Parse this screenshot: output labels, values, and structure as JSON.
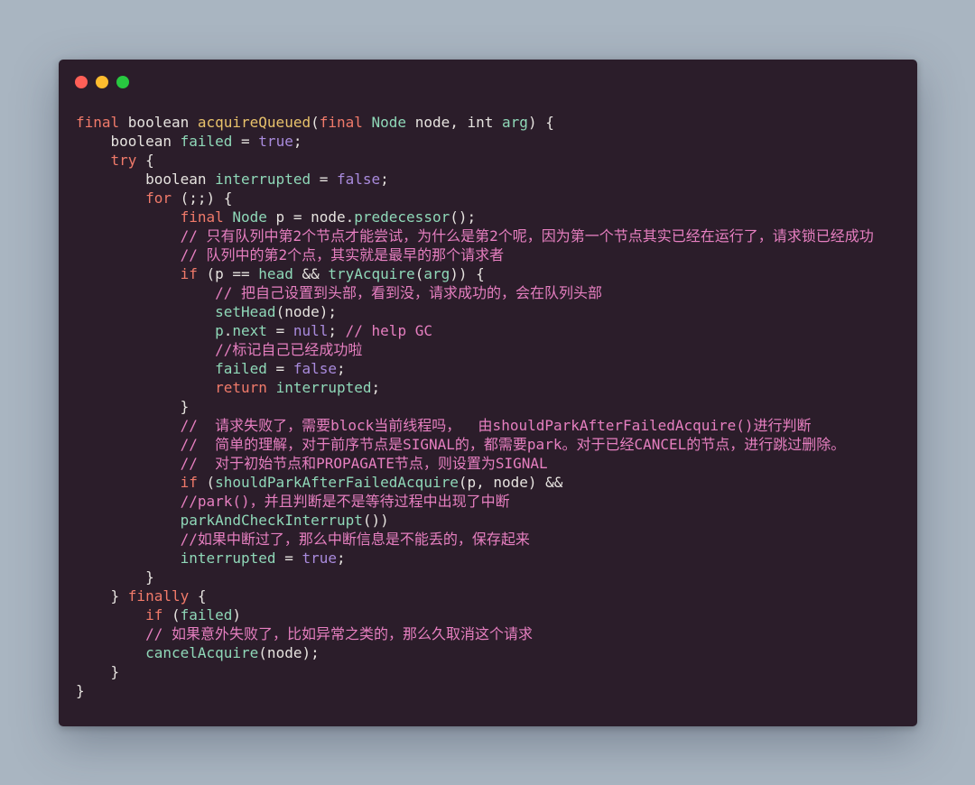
{
  "window": {
    "controls": [
      {
        "name": "close-dot",
        "color": "#ff5f57"
      },
      {
        "name": "minimize-dot",
        "color": "#febc2e"
      },
      {
        "name": "maximize-dot",
        "color": "#28c840"
      }
    ]
  },
  "code": {
    "lines": [
      [
        [
          "kw",
          "final "
        ],
        [
          "type",
          "boolean "
        ],
        [
          "fn",
          "acquireQueued"
        ],
        [
          "plain",
          "("
        ],
        [
          "kw",
          "final "
        ],
        [
          "var",
          "Node "
        ],
        [
          "plain",
          "node, "
        ],
        [
          "type",
          "int "
        ],
        [
          "var",
          "arg"
        ],
        [
          "plain",
          ") {"
        ]
      ],
      [
        [
          "plain",
          "    "
        ],
        [
          "type",
          "boolean "
        ],
        [
          "var",
          "failed"
        ],
        [
          "plain",
          " = "
        ],
        [
          "lit",
          "true"
        ],
        [
          "plain",
          ";"
        ]
      ],
      [
        [
          "plain",
          "    "
        ],
        [
          "kw",
          "try"
        ],
        [
          "plain",
          " {"
        ]
      ],
      [
        [
          "plain",
          "        "
        ],
        [
          "type",
          "boolean "
        ],
        [
          "var",
          "interrupted"
        ],
        [
          "plain",
          " = "
        ],
        [
          "lit",
          "false"
        ],
        [
          "plain",
          ";"
        ]
      ],
      [
        [
          "plain",
          "        "
        ],
        [
          "kw",
          "for"
        ],
        [
          "plain",
          " (;;) {"
        ]
      ],
      [
        [
          "plain",
          "            "
        ],
        [
          "kw",
          "final "
        ],
        [
          "var",
          "Node"
        ],
        [
          "plain",
          " p = node."
        ],
        [
          "var",
          "predecessor"
        ],
        [
          "plain",
          "();"
        ]
      ],
      [
        [
          "plain",
          "            "
        ],
        [
          "cmt",
          "// 只有队列中第2个节点才能尝试，为什么是第2个呢，因为第一个节点其实已经在运行了，请求锁已经成功"
        ]
      ],
      [
        [
          "plain",
          "            "
        ],
        [
          "cmt",
          "// 队列中的第2个点，其实就是最早的那个请求者"
        ]
      ],
      [
        [
          "plain",
          "            "
        ],
        [
          "kw",
          "if"
        ],
        [
          "plain",
          " (p == "
        ],
        [
          "var",
          "head"
        ],
        [
          "plain",
          " && "
        ],
        [
          "var",
          "tryAcquire"
        ],
        [
          "plain",
          "("
        ],
        [
          "var",
          "arg"
        ],
        [
          "plain",
          ")) {"
        ]
      ],
      [
        [
          "plain",
          "                "
        ],
        [
          "cmt",
          "// 把自己设置到头部，看到没，请求成功的，会在队列头部"
        ]
      ],
      [
        [
          "plain",
          "                "
        ],
        [
          "var",
          "setHead"
        ],
        [
          "plain",
          "(node);"
        ]
      ],
      [
        [
          "plain",
          "                "
        ],
        [
          "var",
          "p"
        ],
        [
          "plain",
          "."
        ],
        [
          "var",
          "next"
        ],
        [
          "plain",
          " = "
        ],
        [
          "lit",
          "null"
        ],
        [
          "plain",
          "; "
        ],
        [
          "cmt",
          "// help GC"
        ]
      ],
      [
        [
          "plain",
          "                "
        ],
        [
          "cmt",
          "//标记自己已经成功啦"
        ]
      ],
      [
        [
          "plain",
          "                "
        ],
        [
          "var",
          "failed"
        ],
        [
          "plain",
          " = "
        ],
        [
          "lit",
          "false"
        ],
        [
          "plain",
          ";"
        ]
      ],
      [
        [
          "plain",
          "                "
        ],
        [
          "kw",
          "return "
        ],
        [
          "var",
          "interrupted"
        ],
        [
          "plain",
          ";"
        ]
      ],
      [
        [
          "plain",
          "            }"
        ]
      ],
      [
        [
          "plain",
          "            "
        ],
        [
          "cmt",
          "//  请求失败了，需要block当前线程吗，  由shouldParkAfterFailedAcquire()进行判断"
        ]
      ],
      [
        [
          "plain",
          "            "
        ],
        [
          "cmt",
          "//  简单的理解，对于前序节点是SIGNAL的，都需要park。对于已经CANCEL的节点，进行跳过删除。"
        ]
      ],
      [
        [
          "plain",
          "            "
        ],
        [
          "cmt",
          "//  对于初始节点和PROPAGATE节点，则设置为SIGNAL"
        ]
      ],
      [
        [
          "plain",
          "            "
        ],
        [
          "kw",
          "if"
        ],
        [
          "plain",
          " ("
        ],
        [
          "var",
          "shouldParkAfterFailedAcquire"
        ],
        [
          "plain",
          "(p, node) &&"
        ]
      ],
      [
        [
          "plain",
          "            "
        ],
        [
          "cmt",
          "//park()，并且判断是不是等待过程中出现了中断"
        ]
      ],
      [
        [
          "plain",
          "            "
        ],
        [
          "var",
          "parkAndCheckInterrupt"
        ],
        [
          "plain",
          "())"
        ]
      ],
      [
        [
          "plain",
          "            "
        ],
        [
          "cmt",
          "//如果中断过了，那么中断信息是不能丢的，保存起来"
        ]
      ],
      [
        [
          "plain",
          "            "
        ],
        [
          "var",
          "interrupted"
        ],
        [
          "plain",
          " = "
        ],
        [
          "lit",
          "true"
        ],
        [
          "plain",
          ";"
        ]
      ],
      [
        [
          "plain",
          "        }"
        ]
      ],
      [
        [
          "plain",
          "    } "
        ],
        [
          "kw",
          "finally"
        ],
        [
          "plain",
          " {"
        ]
      ],
      [
        [
          "plain",
          "        "
        ],
        [
          "kw",
          "if"
        ],
        [
          "plain",
          " ("
        ],
        [
          "var",
          "failed"
        ],
        [
          "plain",
          ")"
        ]
      ],
      [
        [
          "plain",
          "        "
        ],
        [
          "cmt",
          "// 如果意外失败了，比如异常之类的，那么久取消这个请求"
        ]
      ],
      [
        [
          "plain",
          "        "
        ],
        [
          "var",
          "cancelAcquire"
        ],
        [
          "plain",
          "(node);"
        ]
      ],
      [
        [
          "plain",
          "    }"
        ]
      ],
      [
        [
          "plain",
          "}"
        ]
      ]
    ]
  }
}
